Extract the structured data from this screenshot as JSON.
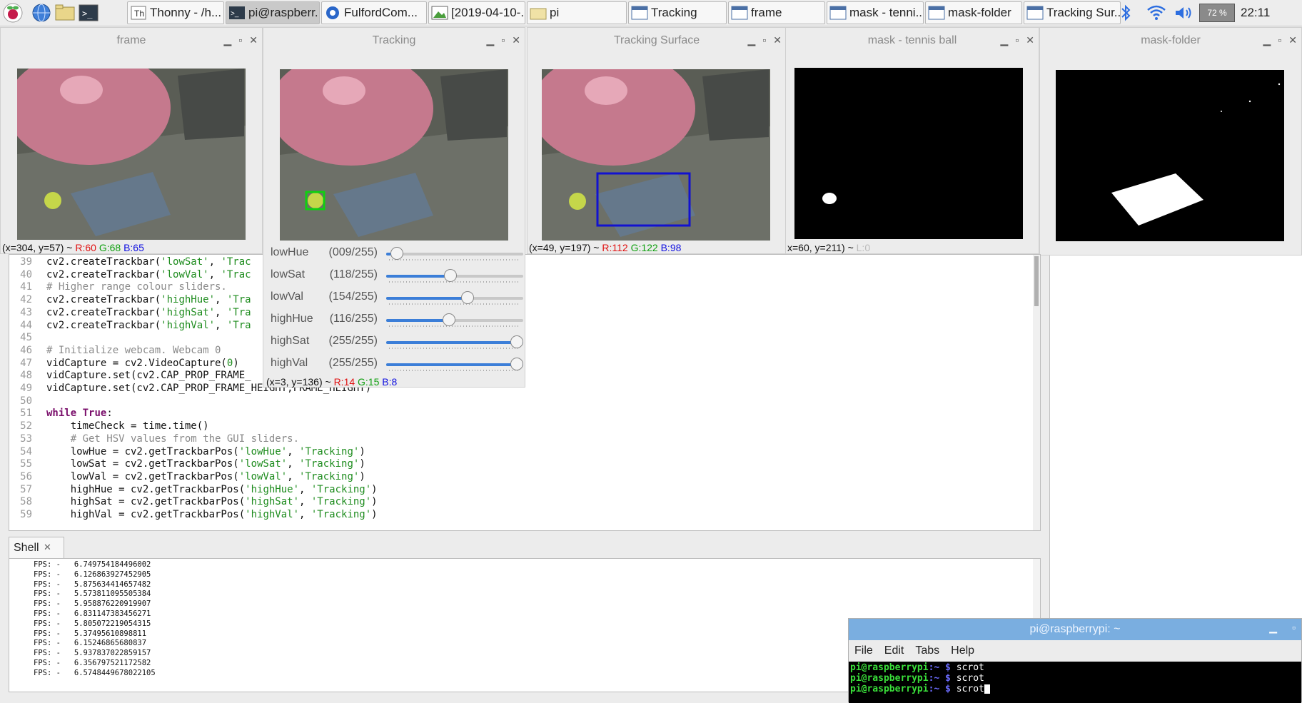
{
  "taskbar": {
    "windows": [
      {
        "label": "Thonny  -  /h...",
        "icon": "thonny-icon",
        "active": false
      },
      {
        "label": "pi@raspberr...",
        "icon": "terminal-icon",
        "active": true
      },
      {
        "label": "FulfordCom...",
        "icon": "chromium-icon",
        "active": false
      },
      {
        "label": "[2019-04-10-...",
        "icon": "image-viewer-icon",
        "active": false
      },
      {
        "label": "pi",
        "icon": "folder-icon",
        "active": false
      },
      {
        "label": "Tracking",
        "icon": "window-icon",
        "active": false
      },
      {
        "label": "frame",
        "icon": "window-icon",
        "active": false
      },
      {
        "label": "mask - tenni...",
        "icon": "window-icon",
        "active": false
      },
      {
        "label": "mask-folder",
        "icon": "window-icon",
        "active": false
      },
      {
        "label": "Tracking Sur...",
        "icon": "window-icon",
        "active": false
      }
    ],
    "battery": "72 %",
    "clock": "22:11"
  },
  "cv_windows": {
    "frame": {
      "title": "frame",
      "status_prefix": "(x=304, y=57) ~ ",
      "r": "R:60",
      "g": "G:68",
      "b": "B:65"
    },
    "tracking": {
      "title": "Tracking",
      "status_prefix": "(x=3, y=136) ~ ",
      "r": "R:14",
      "g": "G:15",
      "b": "B:8"
    },
    "surface": {
      "title": "Tracking Surface",
      "status_prefix": "(x=49, y=197) ~ ",
      "r": "R:112",
      "g": "G:122",
      "b": "B:98"
    },
    "mask_ball": {
      "title": "mask - tennis ball",
      "status_prefix": "x=60, y=211) ~ ",
      "l": "L:0"
    },
    "mask_folder": {
      "title": "mask-folder"
    }
  },
  "sliders": [
    {
      "label": "lowHue",
      "value": "(009/255)",
      "fraction": 0.035
    },
    {
      "label": "lowSat",
      "value": "(118/255)",
      "fraction": 0.463
    },
    {
      "label": "lowVal",
      "value": "(154/255)",
      "fraction": 0.604
    },
    {
      "label": "highHue",
      "value": "(116/255)",
      "fraction": 0.455
    },
    {
      "label": "highSat",
      "value": "(255/255)",
      "fraction": 1.0
    },
    {
      "label": "highVal",
      "value": "(255/255)",
      "fraction": 1.0
    }
  ],
  "editor": {
    "lines": [
      {
        "n": "39",
        "parts": [
          [
            "",
            "cv2.createTrackbar("
          ],
          [
            "st",
            "'lowSat'"
          ],
          [
            "",
            ", "
          ],
          [
            "st",
            "'Trac"
          ]
        ]
      },
      {
        "n": "40",
        "parts": [
          [
            "",
            "cv2.createTrackbar("
          ],
          [
            "st",
            "'lowVal'"
          ],
          [
            "",
            ", "
          ],
          [
            "st",
            "'Trac"
          ]
        ]
      },
      {
        "n": "41",
        "parts": [
          [
            "cm",
            "# Higher range colour sliders."
          ]
        ]
      },
      {
        "n": "42",
        "parts": [
          [
            "",
            "cv2.createTrackbar("
          ],
          [
            "st",
            "'highHue'"
          ],
          [
            "",
            ", "
          ],
          [
            "st",
            "'Tra"
          ]
        ]
      },
      {
        "n": "43",
        "parts": [
          [
            "",
            "cv2.createTrackbar("
          ],
          [
            "st",
            "'highSat'"
          ],
          [
            "",
            ", "
          ],
          [
            "st",
            "'Tra"
          ]
        ]
      },
      {
        "n": "44",
        "parts": [
          [
            "",
            "cv2.createTrackbar("
          ],
          [
            "st",
            "'highVal'"
          ],
          [
            "",
            ", "
          ],
          [
            "st",
            "'Tra"
          ]
        ]
      },
      {
        "n": "45",
        "parts": []
      },
      {
        "n": "46",
        "parts": [
          [
            "cm",
            "# Initialize webcam. Webcam 0"
          ]
        ]
      },
      {
        "n": "47",
        "parts": [
          [
            "",
            "vidCapture = cv2.VideoCapture("
          ],
          [
            "st",
            "0"
          ],
          [
            "",
            ")"
          ]
        ]
      },
      {
        "n": "48",
        "parts": [
          [
            "",
            "vidCapture.set(cv2.CAP_PROP_FRAME_"
          ]
        ]
      },
      {
        "n": "49",
        "parts": [
          [
            "",
            "vidCapture.set(cv2.CAP_PROP_FRAME_HEIGHT,FRAME_HEIGHT)"
          ]
        ]
      },
      {
        "n": "50",
        "parts": []
      },
      {
        "n": "51",
        "parts": [
          [
            "kw",
            "while"
          ],
          [
            "",
            " "
          ],
          [
            "kw",
            "True"
          ],
          [
            "",
            ":"
          ]
        ]
      },
      {
        "n": "52",
        "parts": [
          [
            "",
            "    timeCheck = time.time()"
          ]
        ]
      },
      {
        "n": "53",
        "parts": [
          [
            "cm",
            "    # Get HSV values from the GUI sliders."
          ]
        ]
      },
      {
        "n": "54",
        "parts": [
          [
            "",
            "    lowHue = cv2.getTrackbarPos("
          ],
          [
            "st",
            "'lowHue'"
          ],
          [
            "",
            ", "
          ],
          [
            "st",
            "'Tracking'"
          ],
          [
            "",
            ")"
          ]
        ]
      },
      {
        "n": "55",
        "parts": [
          [
            "",
            "    lowSat = cv2.getTrackbarPos("
          ],
          [
            "st",
            "'lowSat'"
          ],
          [
            "",
            ", "
          ],
          [
            "st",
            "'Tracking'"
          ],
          [
            "",
            ")"
          ]
        ]
      },
      {
        "n": "56",
        "parts": [
          [
            "",
            "    lowVal = cv2.getTrackbarPos("
          ],
          [
            "st",
            "'lowVal'"
          ],
          [
            "",
            ", "
          ],
          [
            "st",
            "'Tracking'"
          ],
          [
            "",
            ")"
          ]
        ]
      },
      {
        "n": "57",
        "parts": [
          [
            "",
            "    highHue = cv2.getTrackbarPos("
          ],
          [
            "st",
            "'highHue'"
          ],
          [
            "",
            ", "
          ],
          [
            "st",
            "'Tracking'"
          ],
          [
            "",
            ")"
          ]
        ]
      },
      {
        "n": "58",
        "parts": [
          [
            "",
            "    highSat = cv2.getTrackbarPos("
          ],
          [
            "st",
            "'highSat'"
          ],
          [
            "",
            ", "
          ],
          [
            "st",
            "'Tracking'"
          ],
          [
            "",
            ")"
          ]
        ]
      },
      {
        "n": "59",
        "parts": [
          [
            "",
            "    highVal = cv2.getTrackbarPos("
          ],
          [
            "st",
            "'highVal'"
          ],
          [
            "",
            ", "
          ],
          [
            "st",
            "'Tracking'"
          ],
          [
            "",
            ")"
          ]
        ]
      }
    ]
  },
  "shell": {
    "tab_label": "Shell",
    "lines": [
      "FPS: -   6.749754184496002",
      "FPS: -   6.126863927452905",
      "FPS: -   5.875634414657482",
      "FPS: -   5.573811095505384",
      "FPS: -   5.958876220919907",
      "FPS: -   6.831147383456271",
      "FPS: -   5.805072219054315",
      "FPS: -   5.37495610898811",
      "FPS: -   6.15246865680837",
      "FPS: -   5.937837022859157",
      "FPS: -   6.356797521172582",
      "FPS: -   6.5748449678022105"
    ]
  },
  "terminal": {
    "title": "pi@raspberrypi: ~",
    "menu": [
      "File",
      "Edit",
      "Tabs",
      "Help"
    ],
    "prompt_user": "pi@raspberrypi",
    "prompt_path": ":~ $",
    "commands": [
      "scrot",
      "scrot",
      "scrot"
    ]
  },
  "colors": {
    "taskbar": "#ededed",
    "terminal_title": "#7aaee0",
    "slider_fill": "#3b7ed8",
    "tracking_box": "#1212d0",
    "ball_marker": "#10d010"
  }
}
